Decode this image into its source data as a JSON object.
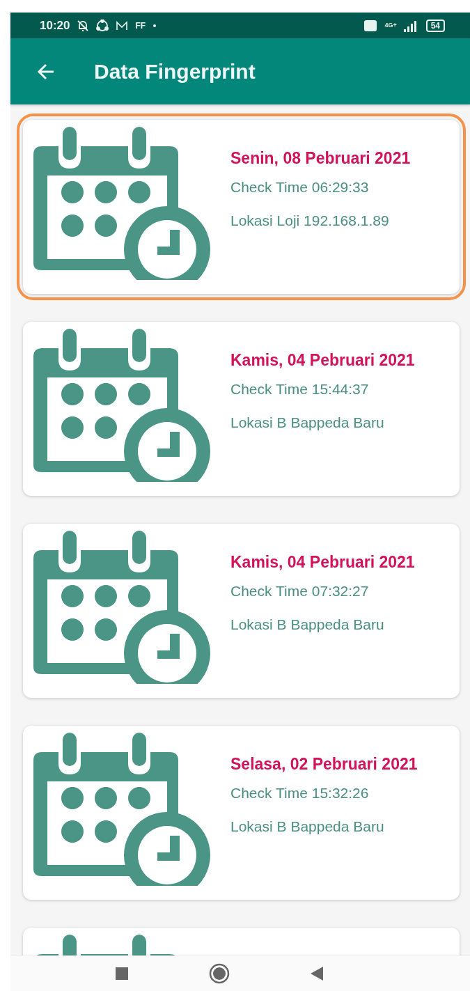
{
  "status_bar": {
    "time": "10:20",
    "app_label": "FF",
    "network": "4G+",
    "battery": "54"
  },
  "app_bar": {
    "title": "Data Fingerprint"
  },
  "records": [
    {
      "date": "Senin, 08 Pebruari 2021",
      "check_time": "Check Time 06:29:33",
      "location": "Lokasi Loji 192.168.1.89",
      "highlighted": true
    },
    {
      "date": "Kamis, 04 Pebruari 2021",
      "check_time": "Check Time 15:44:37",
      "location": "Lokasi B Bappeda Baru",
      "highlighted": false
    },
    {
      "date": "Kamis, 04 Pebruari 2021",
      "check_time": "Check Time 07:32:27",
      "location": "Lokasi B Bappeda Baru",
      "highlighted": false
    },
    {
      "date": "Selasa, 02 Pebruari 2021",
      "check_time": "Check Time 15:32:26",
      "location": "Lokasi B Bappeda Baru",
      "highlighted": false
    },
    {
      "highlighted": false
    }
  ]
}
